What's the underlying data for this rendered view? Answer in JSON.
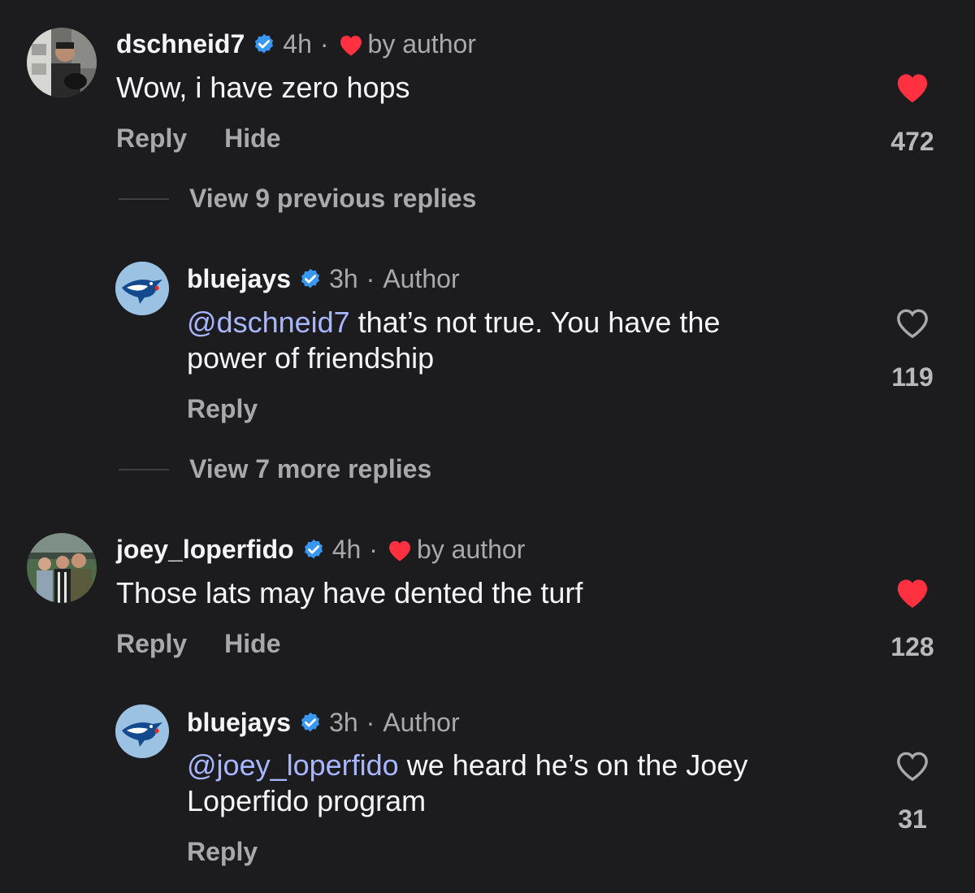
{
  "comments": [
    {
      "username": "dschneid7",
      "time": "4h",
      "separator": "·",
      "liked_by_author_text": "by author",
      "text": "Wow, i have zero hops",
      "actions": [
        "Reply",
        "Hide"
      ],
      "likes": "472",
      "liked": true
    },
    {
      "username": "bluejays",
      "time": "3h",
      "separator": "·",
      "role": "Author",
      "mention": "@dschneid7",
      "text_line1": " that’s not true. You have the",
      "text_line2": "power of friendship",
      "actions": [
        "Reply"
      ],
      "likes": "119",
      "liked": false
    },
    {
      "username": "joey_loperfido",
      "time": "4h",
      "separator": "·",
      "liked_by_author_text": "by author",
      "text": "Those lats may have dented the turf",
      "actions": [
        "Reply",
        "Hide"
      ],
      "likes": "128",
      "liked": true
    },
    {
      "username": "bluejays",
      "time": "3h",
      "separator": "·",
      "role": "Author",
      "mention": "@joey_loperfido",
      "text_line1": " we heard he’s on the Joey",
      "text_line2": "Loperfido program",
      "actions": [
        "Reply"
      ],
      "likes": "31",
      "liked": false
    }
  ],
  "view_previous_replies": "View 9 previous replies",
  "view_more_replies": "View 7 more replies",
  "colors": {
    "background": "#1c1c1f",
    "heart_red": "#ff3040",
    "verified_blue": "#3897f0",
    "mention": "#a7b6ff",
    "secondary_text": "#a8a8ad"
  },
  "icons": [
    "verified-badge-icon",
    "heart-filled-icon",
    "heart-outline-icon",
    "bluejays-logo"
  ]
}
